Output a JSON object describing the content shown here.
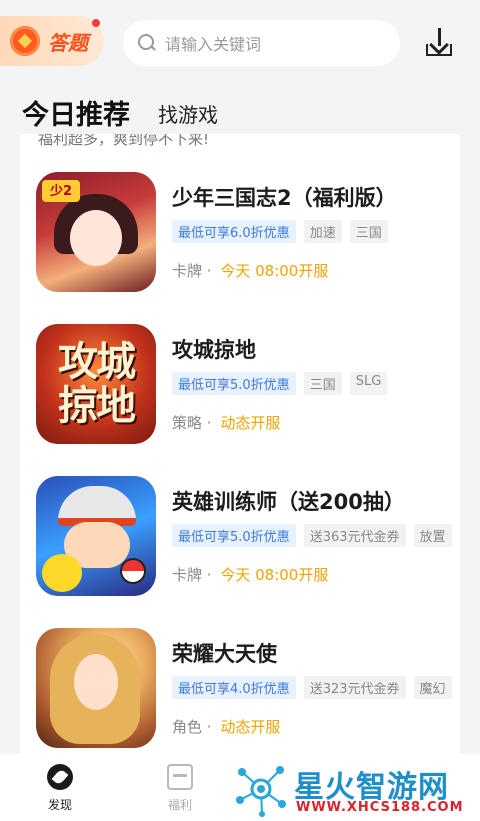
{
  "header": {
    "quiz_label": "答题",
    "search_placeholder": "请输入关键词"
  },
  "tabs": [
    {
      "label": "今日推荐",
      "active": true
    },
    {
      "label": "找游戏",
      "active": false
    }
  ],
  "section": {
    "partial_text": "福利超多，爽到停不下来!"
  },
  "games": [
    {
      "title": "少年三国志2（福利版）",
      "icon": "shaonian-sanguozhi-icon",
      "tags": [
        {
          "label": "最低可享6.0折优惠",
          "kind": "promo"
        },
        {
          "label": "加速",
          "kind": "plain"
        },
        {
          "label": "三国",
          "kind": "plain"
        }
      ],
      "genre": "卡牌",
      "open": "今天 08:00开服"
    },
    {
      "title": "攻城掠地",
      "icon": "gongcheng-luedi-icon",
      "icon_text": "攻城掠地",
      "tags": [
        {
          "label": "最低可享5.0折优惠",
          "kind": "promo"
        },
        {
          "label": "三国",
          "kind": "plain"
        },
        {
          "label": "SLG",
          "kind": "plain"
        }
      ],
      "genre": "策略",
      "open": "动态开服"
    },
    {
      "title": "英雄训练师（送200抽）",
      "icon": "yingxiong-xunlianshi-icon",
      "tags": [
        {
          "label": "最低可享5.0折优惠",
          "kind": "promo"
        },
        {
          "label": "送363元代金券",
          "kind": "plain"
        },
        {
          "label": "放置",
          "kind": "plain"
        }
      ],
      "genre": "卡牌",
      "open": "今天 08:00开服"
    },
    {
      "title": "荣耀大天使",
      "icon": "rongyao-datianshi-icon",
      "tags": [
        {
          "label": "最低可享4.0折优惠",
          "kind": "promo"
        },
        {
          "label": "送323元代金券",
          "kind": "plain"
        },
        {
          "label": "魔幻",
          "kind": "plain"
        }
      ],
      "genre": "角色",
      "open": "动态开服"
    }
  ],
  "bottom_nav": [
    {
      "label": "发现",
      "icon": "compass-icon",
      "active": true
    },
    {
      "label": "福利",
      "icon": "gift-icon",
      "active": false
    }
  ],
  "watermark": {
    "text": "星火智游网",
    "url": "WWW.XHCS188.COM"
  },
  "colors": {
    "promo": "#3d7be0",
    "open_time": "#f5a300",
    "quiz": "#ff4f1a",
    "watermark": "#1f8fc9"
  }
}
